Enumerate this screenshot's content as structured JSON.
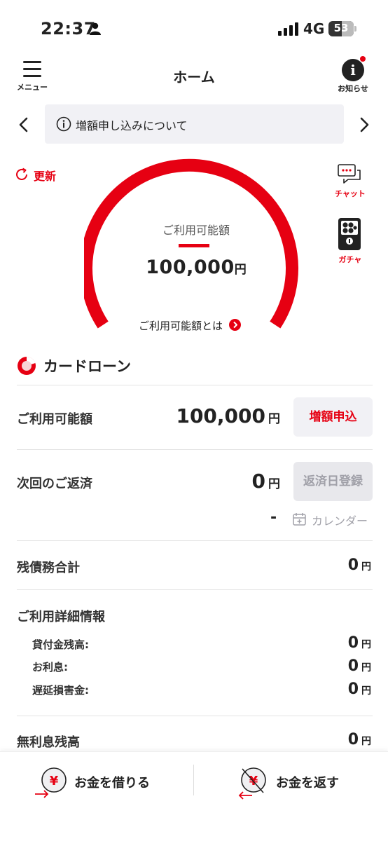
{
  "status_bar": {
    "time": "22:37",
    "network": "4G",
    "battery": "53"
  },
  "header": {
    "menu_label": "メニュー",
    "title": "ホーム",
    "news_label": "お知らせ"
  },
  "banner": {
    "text": "増額申し込みについて"
  },
  "refresh": {
    "label": "更新"
  },
  "gauge": {
    "caption": "ご利用可能額",
    "amount": "100,000",
    "currency": "円",
    "link_label": "ご利用可能額とは",
    "fill_fraction": 1.0
  },
  "side_buttons": {
    "chat_label": "チャット",
    "gacha_label": "ガチャ"
  },
  "card_loan": {
    "title": "カードローン",
    "available": {
      "label": "ご利用可能額",
      "value": "100,000",
      "currency": "円",
      "button": "増額申込"
    },
    "next_payment": {
      "label": "次回のご返済",
      "value": "0",
      "currency": "円",
      "button": "返済日登録",
      "date": "-",
      "calendar_label": "カレンダー"
    },
    "total_debt": {
      "label": "残債務合計",
      "value": "0",
      "currency": "円"
    },
    "details": {
      "label": "ご利用詳細情報",
      "items": [
        {
          "label": "貸付金残高:",
          "value": "0",
          "currency": "円"
        },
        {
          "label": "お利息:",
          "value": "0",
          "currency": "円"
        },
        {
          "label": "遅延損害金:",
          "value": "0",
          "currency": "円"
        }
      ]
    },
    "interest_free": {
      "label": "無利息残高",
      "value": "0",
      "currency": "円"
    }
  },
  "bottom_bar": {
    "borrow_label": "お金を借りる",
    "repay_label": "お金を返す"
  },
  "colors": {
    "accent": "#e60012",
    "panel": "#f1f1f5",
    "disabled_text": "#a0a0a8"
  }
}
